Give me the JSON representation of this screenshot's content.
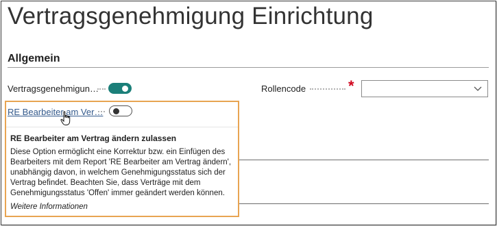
{
  "page": {
    "title": "Vertragsgenehmigung Einrichtung"
  },
  "section": {
    "title": "Allgemein"
  },
  "fields": {
    "vertragsgenehmigung": {
      "label": "Vertragsgenehmigun…",
      "value": true
    },
    "re_bearbeiter": {
      "label": "RE Bearbeiter am Ver…",
      "value": false
    },
    "rollencode": {
      "label": "Rollencode",
      "value": "",
      "required": true
    }
  },
  "tooltip": {
    "title": "RE Bearbeiter am Vertrag ändern zulassen",
    "lines": [
      "Diese Option ermöglicht eine Korrektur bzw. ein Einfügen des",
      "Bearbeiters mit dem Report 'RE Bearbeiter am Vertrag ändern',",
      "unabhängig davon, in welchem Genehmigungsstatus sich der",
      "Vertrag befindet. Beachten Sie, dass Verträge mit dem",
      "Genehmigungsstatus 'Offen' immer geändert werden können."
    ],
    "more_link": "Weitere Informationen"
  },
  "colors": {
    "toggle_on": "#1b7f79",
    "required": "#d0021b",
    "highlight": "#e8a452",
    "link": "#345a8c"
  },
  "icons": {
    "required": "asterisk-icon",
    "dropdown": "chevron-down-icon",
    "cursor": "hand-pointer-icon"
  }
}
